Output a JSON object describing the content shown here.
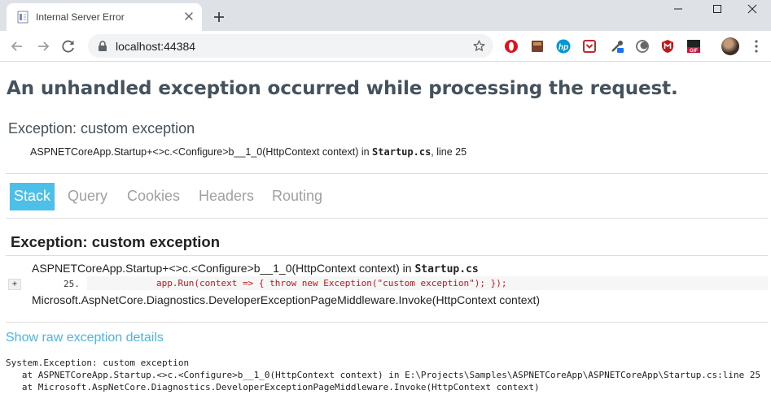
{
  "browser": {
    "tab_title": "Internal Server Error",
    "url": "localhost:44384"
  },
  "page": {
    "heading": "An unhandled exception occurred while processing the request.",
    "exception_title": "Exception: custom exception",
    "location": {
      "method": "ASPNETCoreApp.Startup+<>c.<Configure>b__1_0(HttpContext context) in ",
      "file": "Startup.cs",
      "line_text": ", line 25"
    },
    "tabs": [
      "Stack",
      "Query",
      "Cookies",
      "Headers",
      "Routing"
    ],
    "stack": {
      "title": "Exception: custom exception",
      "frame1_method": "ASPNETCoreApp.Startup+<>c.<Configure>b__1_0(HttpContext context) in ",
      "frame1_file": "Startup.cs",
      "expander": "+",
      "line_number": "25.",
      "code": "app.Run(context => { throw new Exception(\"custom exception\"); });",
      "frame2_method": "Microsoft.AspNetCore.Diagnostics.DeveloperExceptionPageMiddleware.Invoke(HttpContext context)"
    },
    "raw_link": "Show raw exception details",
    "raw_lines": [
      "System.Exception: custom exception",
      "   at ASPNETCoreApp.Startup.<>c.<Configure>b__1_0(HttpContext context) in E:\\Projects\\Samples\\ASPNETCoreApp\\ASPNETCoreApp\\Startup.cs:line 25",
      "   at Microsoft.AspNetCore.Diagnostics.DeveloperExceptionPageMiddleware.Invoke(HttpContext context)"
    ]
  },
  "theme": {
    "accent": "#4cc0e9",
    "link": "#4cb5e6",
    "heading": "#44525e",
    "code_red": "#c7151b"
  },
  "icons": [
    "document-favicon-icon",
    "close-icon",
    "plus-icon",
    "minimize-icon",
    "maximize-icon",
    "window-close-icon",
    "back-arrow-icon",
    "forward-arrow-icon",
    "reload-icon",
    "lock-icon",
    "star-icon",
    "opera-extension-icon",
    "book-extension-icon",
    "hp-extension-icon",
    "pocket-extension-icon",
    "eyedropper-extension-icon",
    "moon-extension-icon",
    "mcafee-extension-icon",
    "gif-extension-icon",
    "profile-avatar",
    "kebab-menu-icon"
  ]
}
